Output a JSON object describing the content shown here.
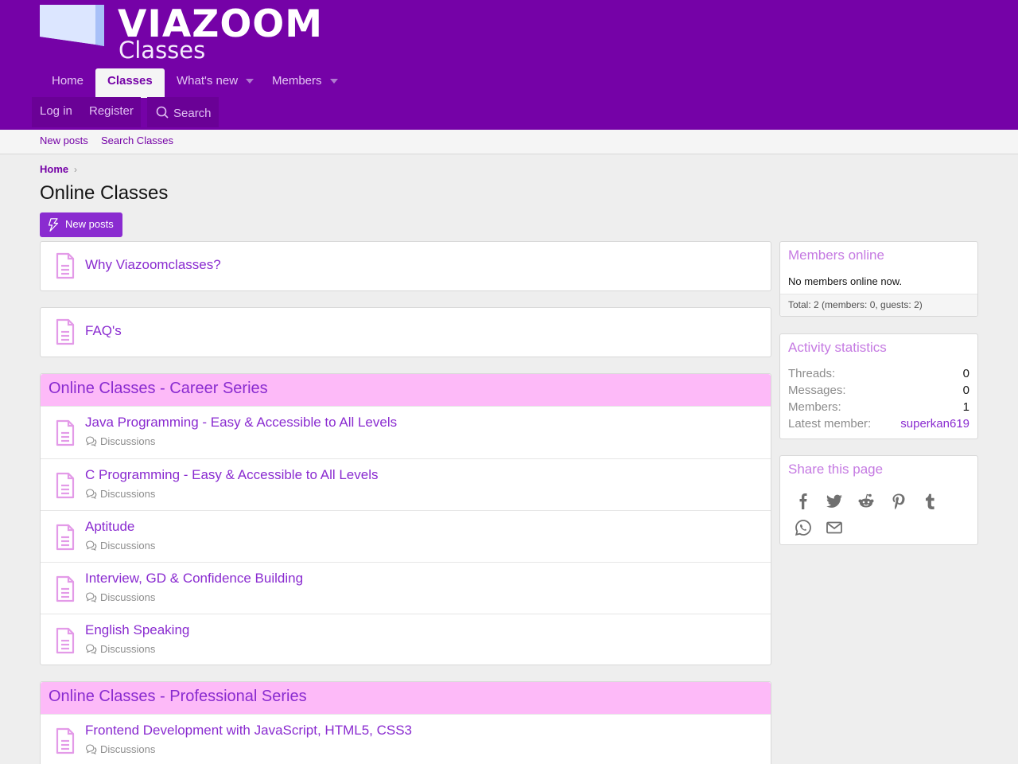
{
  "brand": {
    "name": "VIAZOOM",
    "subtitle": "Classes"
  },
  "nav": {
    "tabs": [
      {
        "label": "Home"
      },
      {
        "label": "Classes"
      },
      {
        "label": "What's new"
      },
      {
        "label": "Members"
      }
    ],
    "login": "Log in",
    "register": "Register",
    "search": "Search"
  },
  "subnav": {
    "items": [
      {
        "label": "New posts"
      },
      {
        "label": "Search Classes"
      }
    ]
  },
  "breadcrumb": {
    "home": "Home"
  },
  "page": {
    "title": "Online Classes",
    "new_posts_button": "New posts"
  },
  "nodes": {
    "why": "Why Viazoomclasses?",
    "faq": "FAQ's"
  },
  "categories": [
    {
      "title": "Online Classes - Career Series",
      "forums": [
        {
          "title": "Java Programming - Easy & Accessible to All Levels",
          "sub": "Discussions"
        },
        {
          "title": "C Programming - Easy & Accessible to All Levels",
          "sub": "Discussions"
        },
        {
          "title": "Aptitude",
          "sub": "Discussions"
        },
        {
          "title": "Interview, GD & Confidence Building",
          "sub": "Discussions"
        },
        {
          "title": "English Speaking",
          "sub": "Discussions"
        }
      ]
    },
    {
      "title": "Online Classes - Professional Series",
      "forums": [
        {
          "title": "Frontend Development with JavaScript, HTML5, CSS3",
          "sub": "Discussions"
        }
      ]
    }
  ],
  "sidebar": {
    "members_online": {
      "title": "Members online",
      "text": "No members online now.",
      "footer": "Total: 2 (members: 0, guests: 2)"
    },
    "activity": {
      "title": "Activity statistics",
      "stats": [
        {
          "label": "Threads:",
          "value": "0"
        },
        {
          "label": "Messages:",
          "value": "0"
        },
        {
          "label": "Members:",
          "value": "1"
        },
        {
          "label": "Latest member:",
          "value": "superkan619"
        }
      ]
    },
    "share": {
      "title": "Share this page",
      "icons": [
        "facebook-icon",
        "twitter-icon",
        "reddit-icon",
        "pinterest-icon",
        "tumblr-icon",
        "whatsapp-icon",
        "email-icon"
      ]
    }
  },
  "colors": {
    "header_bg": "#7502a7",
    "accent": "#8a2bd0",
    "category_header_bg": "#fdbaf8",
    "icon_pink": "#e39ae8"
  }
}
